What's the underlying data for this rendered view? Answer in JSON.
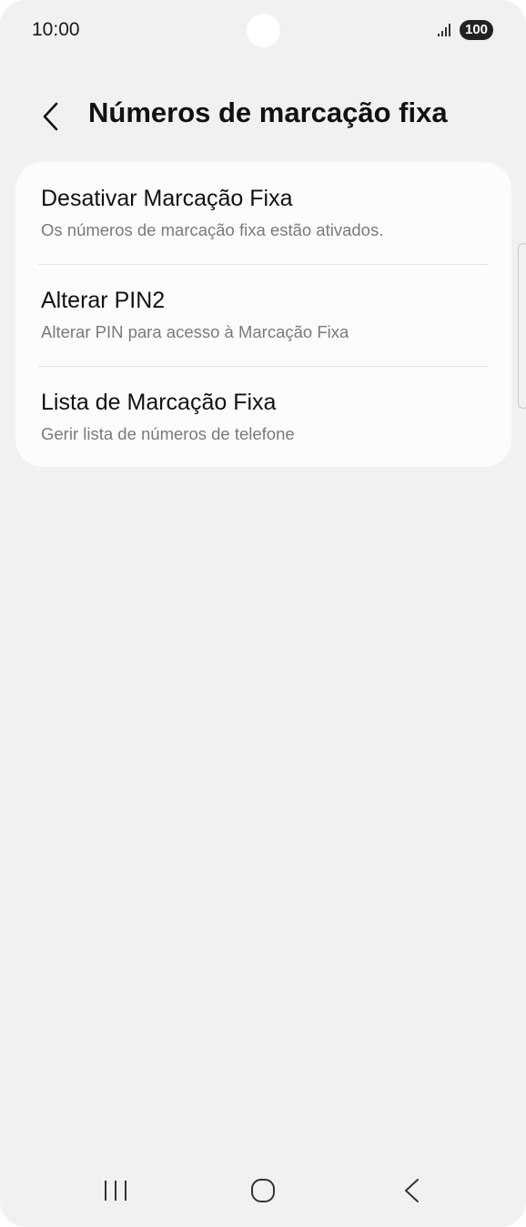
{
  "status_bar": {
    "time": "10:00",
    "battery": "100",
    "icons": [
      "camera-cutout",
      "signal-icon",
      "battery-icon"
    ]
  },
  "header": {
    "back_icon": "chevron-left-icon",
    "title": "Números de marcação fixa"
  },
  "settings": {
    "items": [
      {
        "title": "Desativar Marcação Fixa",
        "subtitle": "Os números de marcação fixa estão ativados."
      },
      {
        "title": "Alterar PIN2",
        "subtitle": "Alterar PIN para acesso à Marcação Fixa"
      },
      {
        "title": "Lista de Marcação Fixa",
        "subtitle": "Gerir lista de números de telefone"
      }
    ]
  },
  "nav_bar": {
    "icons": [
      "recent-apps-icon",
      "home-icon",
      "back-icon"
    ]
  },
  "colors": {
    "background": "#f1f1f3",
    "card": "#fcfcfe",
    "primary_text": "#111111",
    "secondary_text": "#7a7a7a",
    "divider": "#e2e2e4"
  }
}
